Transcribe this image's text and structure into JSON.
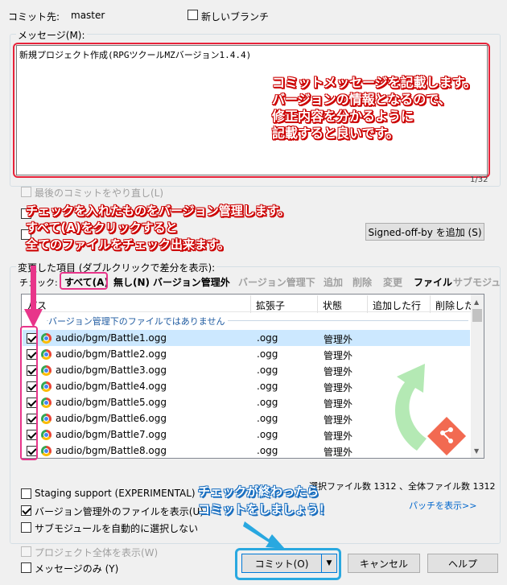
{
  "header": {
    "commit_to_label": "コミット先:",
    "branch": "master",
    "new_branch_label": "新しいブランチ"
  },
  "message": {
    "label": "メッセージ(M):",
    "value": "新規プロジェクト作成(RPGツクールMZバージョン1.4.4)",
    "counter": "1/32",
    "amend_label": "最後のコミットをやり直し(L)",
    "signoff_button": "Signed-off-by を追加 (S)"
  },
  "changes": {
    "title": "変更した項目 (ダブルクリックで差分を表示):",
    "check_label": "チェック:",
    "filters": [
      "すべて(A)",
      "無し(N)",
      "バージョン管理外",
      "バージョン管理下",
      "追加",
      "削除",
      "変更",
      "ファイル",
      "サブモジュール"
    ],
    "columns": [
      "パス",
      "拡張子",
      "状態",
      "追加した行",
      "削除した行"
    ],
    "group_header": "バージョン管理下のファイルではありません",
    "rows": [
      {
        "path": "audio/bgm/Battle1.ogg",
        "ext": ".ogg",
        "status": "管理外",
        "checked": true
      },
      {
        "path": "audio/bgm/Battle2.ogg",
        "ext": ".ogg",
        "status": "管理外",
        "checked": true
      },
      {
        "path": "audio/bgm/Battle3.ogg",
        "ext": ".ogg",
        "status": "管理外",
        "checked": true
      },
      {
        "path": "audio/bgm/Battle4.ogg",
        "ext": ".ogg",
        "status": "管理外",
        "checked": true
      },
      {
        "path": "audio/bgm/Battle5.ogg",
        "ext": ".ogg",
        "status": "管理外",
        "checked": true
      },
      {
        "path": "audio/bgm/Battle6.ogg",
        "ext": ".ogg",
        "status": "管理外",
        "checked": true
      },
      {
        "path": "audio/bgm/Battle7.ogg",
        "ext": ".ogg",
        "status": "管理外",
        "checked": true
      },
      {
        "path": "audio/bgm/Battle8.ogg",
        "ext": ".ogg",
        "status": "管理外",
        "checked": true
      }
    ],
    "file_count": "選択ファイル数 1312 、全体ファイル数 1312",
    "show_patch": "パッチを表示>>"
  },
  "options": {
    "staging_support": "Staging support (EXPERIMENTAL)",
    "show_unversioned": "バージョン管理外のファイルを表示(U)",
    "auto_select_submodules": "サブモジュールを自動的に選択しない",
    "show_whole_project": "プロジェクト全体を表示(W)",
    "message_only": "メッセージのみ (Y)"
  },
  "buttons": {
    "commit": "コミット(O)",
    "cancel": "キャンセル",
    "help": "ヘルプ"
  },
  "annotations": {
    "message_note": [
      "コミットメッセージを記載します。",
      "バージョンの情報となるので、",
      "修正内容を分かるように",
      "記載すると良いです。"
    ],
    "check_note": [
      "チェックを入れたものをバージョン管理します。",
      "すべて(A)をクリックすると",
      "全てのファイルをチェック出来ます。"
    ],
    "commit_note": [
      "チェックが終わったら",
      "コミットをしましょう！"
    ]
  },
  "colors": {
    "annotation_red": "#e8233a",
    "annotation_pink": "#e8358a",
    "annotation_blue": "#29a8e0",
    "link": "#0066cc"
  }
}
